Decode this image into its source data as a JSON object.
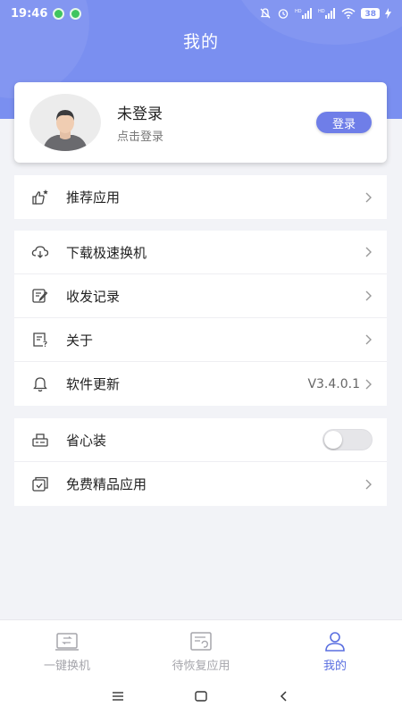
{
  "status_bar": {
    "time": "19:46",
    "battery": "38",
    "network_badges": [
      "HD",
      "HD"
    ]
  },
  "header": {
    "title": "我的"
  },
  "user_card": {
    "name": "未登录",
    "subtitle": "点击登录",
    "login_button": "登录"
  },
  "menu": {
    "section1": [
      {
        "label": "推荐应用",
        "icon": "thumbs-up-star-icon"
      }
    ],
    "section2": [
      {
        "label": "下载极速换机",
        "icon": "cloud-download-icon"
      },
      {
        "label": "收发记录",
        "icon": "edit-record-icon"
      },
      {
        "label": "关于",
        "icon": "info-doc-icon"
      },
      {
        "label": "软件更新",
        "icon": "bell-icon",
        "value": "V3.4.0.1"
      }
    ],
    "section3": [
      {
        "label": "省心装",
        "icon": "installer-icon",
        "toggle_on": false
      },
      {
        "label": "免费精品应用",
        "icon": "app-box-icon"
      }
    ]
  },
  "bottom_nav": [
    {
      "label": "一键换机",
      "icon": "phone-transfer-icon",
      "active": false
    },
    {
      "label": "待恢复应用",
      "icon": "restore-list-icon",
      "active": false
    },
    {
      "label": "我的",
      "icon": "person-icon",
      "active": true
    }
  ],
  "colors": {
    "accent": "#6f7ee8",
    "header": "#7a8ff0",
    "active_tab": "#5a6fe0"
  }
}
